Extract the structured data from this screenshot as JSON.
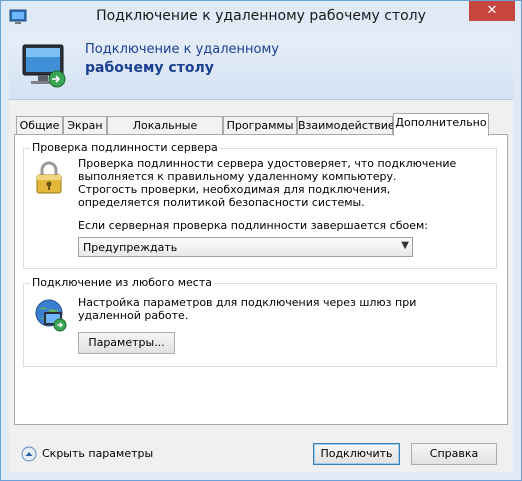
{
  "window": {
    "title": "Подключение к удаленному рабочему столу",
    "close_glyph": "✕"
  },
  "banner": {
    "line1": "Подключение к удаленному",
    "line2": "рабочему столу"
  },
  "tabs": [
    {
      "label": "Общие",
      "active": false
    },
    {
      "label": "Экран",
      "active": false
    },
    {
      "label": "Локальные ресурсы",
      "active": false
    },
    {
      "label": "Программы",
      "active": false
    },
    {
      "label": "Взаимодействие",
      "active": false
    },
    {
      "label": "Дополнительно",
      "active": true
    }
  ],
  "auth_group": {
    "title": "Проверка подлинности сервера",
    "desc1": "Проверка подлинности сервера удостоверяет, что подключение",
    "desc2": "выполняется к правильному удаленному компьютеру.",
    "desc3": "Строгость проверки, необходимая для подключения,",
    "desc4": "определяется политикой безопасности системы.",
    "fail_label": "Если серверная проверка подлинности завершается сбоем:",
    "fail_value": "Предупреждать",
    "icon": "lock-icon"
  },
  "gateway_group": {
    "title": "Подключение из любого места",
    "desc1": "Настройка параметров для подключения через шлюз при",
    "desc2": "удаленной работе.",
    "button": "Параметры...",
    "icon": "globe-connection-icon"
  },
  "footer": {
    "toggle_label": "Скрыть параметры",
    "connect_button": "Подключить",
    "help_button": "Справка"
  },
  "colors": {
    "accent": "#1b3f91",
    "close": "#c7463f",
    "frame": "#dfeaf6"
  }
}
